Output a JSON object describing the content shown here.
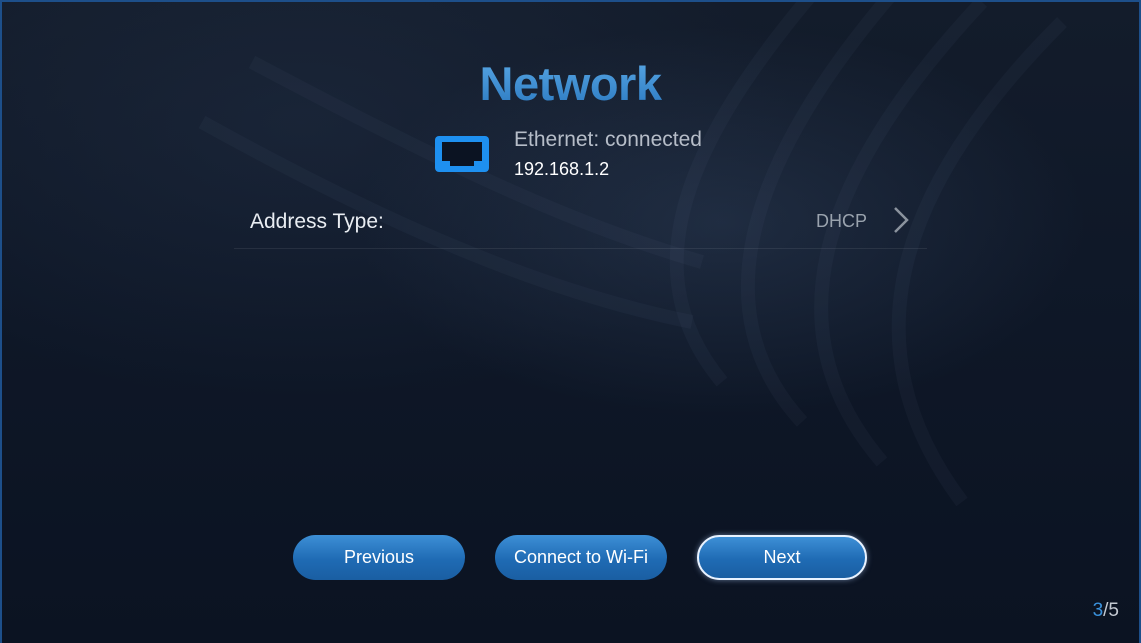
{
  "header": {
    "title": "Network"
  },
  "ethernet": {
    "icon": "ethernet-port-icon",
    "status": "Ethernet: connected",
    "ip": "192.168.1.2"
  },
  "settings": {
    "address_type": {
      "label": "Address Type:",
      "value": "DHCP",
      "icon": "chevron-right-icon"
    }
  },
  "buttons": {
    "previous": "Previous",
    "connect_wifi": "Connect to Wi-Fi",
    "next": "Next"
  },
  "pager": {
    "current": "3",
    "total": "/5"
  },
  "colors": {
    "accent": "#3a8fd4",
    "button": "#2a78c0",
    "background": "#0f1828"
  }
}
